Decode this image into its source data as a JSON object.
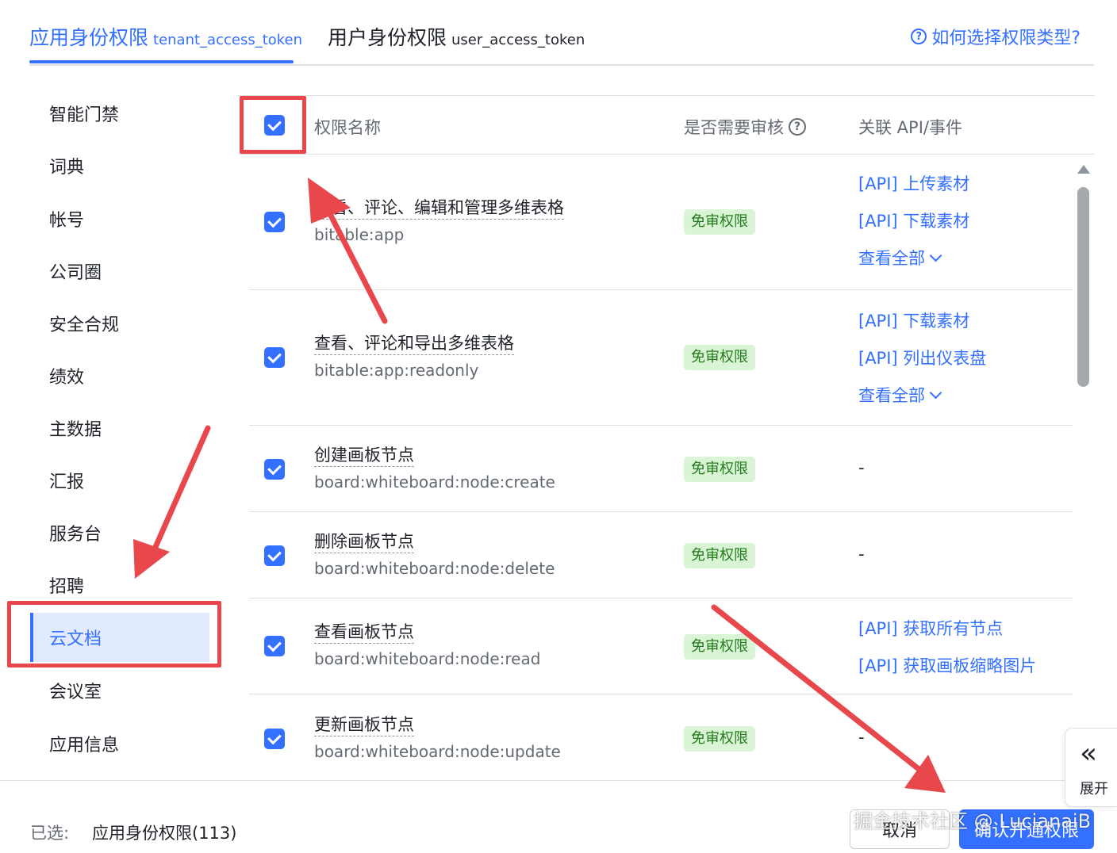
{
  "tabs": {
    "app": {
      "label": "应用身份权限",
      "sub": "tenant_access_token"
    },
    "user": {
      "label": "用户身份权限",
      "sub": "user_access_token"
    },
    "help_link": "如何选择权限类型?"
  },
  "sidebar": {
    "items": [
      {
        "label": "智能门禁"
      },
      {
        "label": "词典"
      },
      {
        "label": "帐号"
      },
      {
        "label": "公司圈"
      },
      {
        "label": "安全合规"
      },
      {
        "label": "绩效"
      },
      {
        "label": "主数据"
      },
      {
        "label": "汇报"
      },
      {
        "label": "服务台"
      },
      {
        "label": "招聘"
      },
      {
        "label": "云文档"
      },
      {
        "label": "会议室"
      },
      {
        "label": "应用信息"
      }
    ],
    "active": "云文档"
  },
  "table": {
    "columns": {
      "name": "权限名称",
      "review": "是否需要审核",
      "related": "关联 API/事件"
    },
    "rows": [
      {
        "title": "查看、评论、编辑和管理多维表格",
        "key": "bitable:app",
        "review": "免审权限",
        "apis": [
          "[API] 上传素材",
          "[API] 下载素材"
        ],
        "more": "查看全部"
      },
      {
        "title": "查看、评论和导出多维表格",
        "key": "bitable:app:readonly",
        "review": "免审权限",
        "apis": [
          "[API] 下载素材",
          "[API] 列出仪表盘"
        ],
        "more": "查看全部"
      },
      {
        "title": "创建画板节点",
        "key": "board:whiteboard:node:create",
        "review": "免审权限",
        "dash": "-"
      },
      {
        "title": "删除画板节点",
        "key": "board:whiteboard:node:delete",
        "review": "免审权限",
        "dash": "-"
      },
      {
        "title": "查看画板节点",
        "key": "board:whiteboard:node:read",
        "review": "免审权限",
        "apis": [
          "[API] 获取所有节点",
          "[API] 获取画板缩略图片"
        ]
      },
      {
        "title": "更新画板节点",
        "key": "board:whiteboard:node:update",
        "review": "免审权限",
        "dash": "-"
      }
    ]
  },
  "expand": {
    "label": "展开"
  },
  "footer": {
    "selected_label": "已选:",
    "selected_value": "应用身份权限(113)",
    "cancel": "取消",
    "confirm": "确认开通权限"
  },
  "watermark": "掘金技术社区 @ LucianaiB",
  "colors": {
    "accent": "#3370ff",
    "annotation": "#e8474c",
    "badge_bg": "#d9f5d6",
    "badge_text": "#237b19"
  }
}
